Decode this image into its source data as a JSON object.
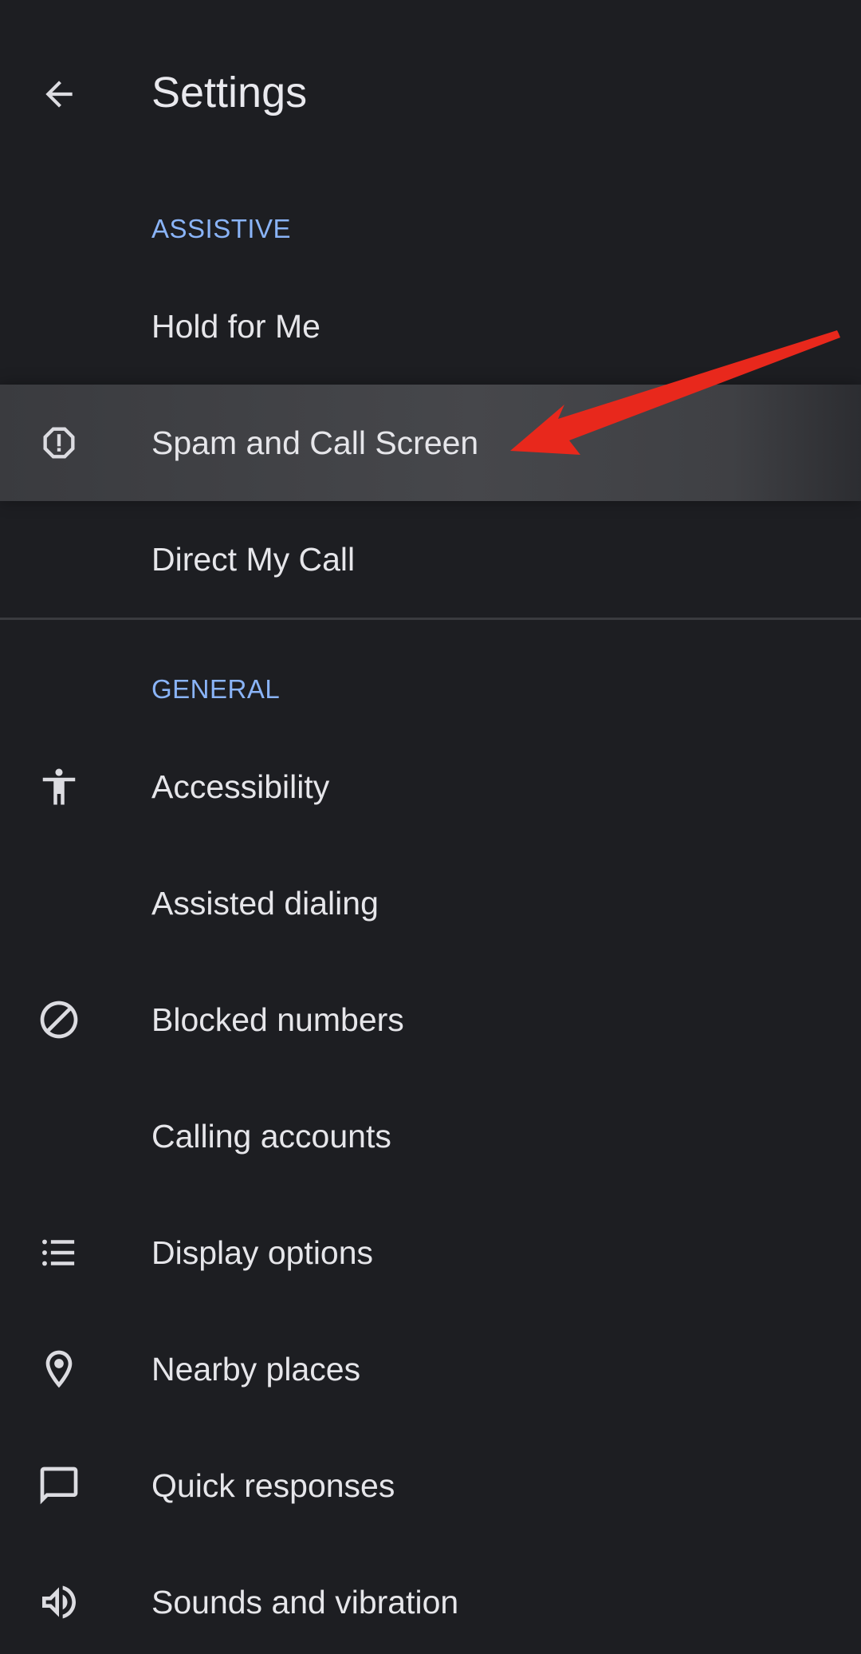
{
  "header": {
    "title": "Settings",
    "back_icon": "arrow-back-icon"
  },
  "sections": {
    "assistive": {
      "title": "ASSISTIVE",
      "items": [
        {
          "label": "Hold for Me",
          "icon": null
        },
        {
          "label": "Spam and Call Screen",
          "icon": "spam-alert-icon"
        },
        {
          "label": "Direct My Call",
          "icon": null
        }
      ]
    },
    "general": {
      "title": "GENERAL",
      "items": [
        {
          "label": "Accessibility",
          "icon": "accessibility-icon"
        },
        {
          "label": "Assisted dialing",
          "icon": null
        },
        {
          "label": "Blocked numbers",
          "icon": "block-icon"
        },
        {
          "label": "Calling accounts",
          "icon": null
        },
        {
          "label": "Display options",
          "icon": "list-icon"
        },
        {
          "label": "Nearby places",
          "icon": "location-pin-icon"
        },
        {
          "label": "Quick responses",
          "icon": "chat-bubble-icon"
        },
        {
          "label": "Sounds and vibration",
          "icon": "volume-icon"
        }
      ]
    }
  },
  "colors": {
    "background": "#1d1e22",
    "section_header": "#8ab4f8",
    "text": "#e6e6ea",
    "highlight": "#46474b",
    "annotation_arrow": "#e8281c"
  }
}
